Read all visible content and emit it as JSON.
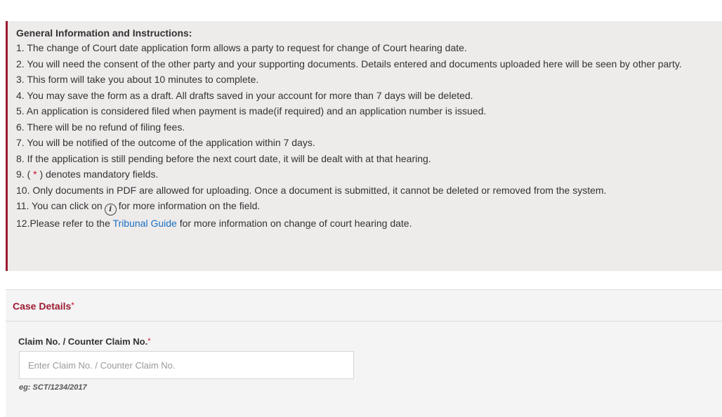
{
  "instructions": {
    "title": "General Information and Instructions:",
    "items": [
      "1. The change of Court date application form allows a party to request for change of Court hearing date.",
      "2. You will need the consent of the other party and your supporting documents. Details entered and documents uploaded here will be seen by other party.",
      "3. This form will take you about 10 minutes to complete.",
      "4. You may save the form as a draft. All drafts saved in your account for more than 7 days will be deleted.",
      "5. An application is considered filed when payment is made(if required) and an application number is issued.",
      "6. There will be no refund of filing fees.",
      "7. You will be notified of the outcome of the application within 7 days.",
      "8. If the application is still pending before the next court date, it will be dealt with at that hearing."
    ],
    "item9": {
      "prefix": "9. ( ",
      "star": "*",
      "suffix": " ) denotes mandatory fields."
    },
    "item10": "10. Only documents in PDF are allowed for uploading. Once a document is submitted, it cannot be deleted or removed from the system.",
    "item11": {
      "prefix": "11. You can click on",
      "icon_glyph": "i",
      "suffix": "for more information on the field."
    },
    "item12": {
      "prefix": "12.Please refer to the ",
      "link": "Tribunal Guide",
      "suffix": " for more information on change of court hearing date."
    }
  },
  "case_details": {
    "title": "Case Details",
    "required_mark": "*",
    "claim_field": {
      "label": "Claim No. / Counter Claim No.",
      "required_mark": "*",
      "value": "",
      "placeholder": "Enter Claim No. / Counter Claim No.",
      "hint": "eg: SCT/1234/2017"
    }
  },
  "colors": {
    "accent": "#9b1b30",
    "required": "#c8102e",
    "link": "#1a70c1",
    "info_background": "#eeebeb",
    "panel_background": "#f5f4f4"
  }
}
